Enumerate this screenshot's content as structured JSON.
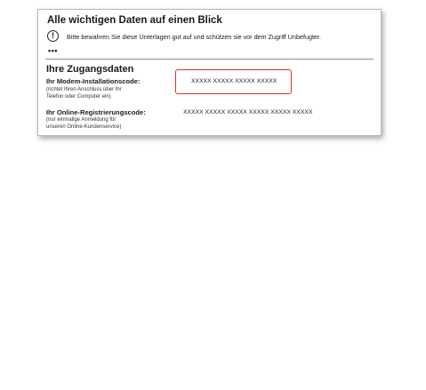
{
  "card": {
    "title": "Alle wichtigen Daten auf einen Blick",
    "hint": "Bitte bewahren Sie diese Unterlagen gut auf und schützen sie vor dem Zugriff Unbefugter.",
    "info_icon": "info-circle-icon",
    "info_icon_glyph": "!",
    "more": "•••"
  },
  "access": {
    "title": "Ihre Zugangsdaten",
    "modem": {
      "label": "Ihr Modem-Installationscode:",
      "sub_line1": "(richtet Ihren Anschluss über Ihr",
      "sub_line2": "Telefon oder Computer ein)",
      "value": "XXXXX XXXXX XXXXX XXXXX",
      "highlight_color": "#e0301e"
    },
    "online": {
      "label": "Ihr Online-Registrierungscode:",
      "sub_line1": "(nur einmalige Anmeldung für",
      "sub_line2": "unseren Online-Kundenservice)",
      "value": "XXXXX XXXXX XXXXX XXXXX XXXXX XXXXX"
    }
  }
}
